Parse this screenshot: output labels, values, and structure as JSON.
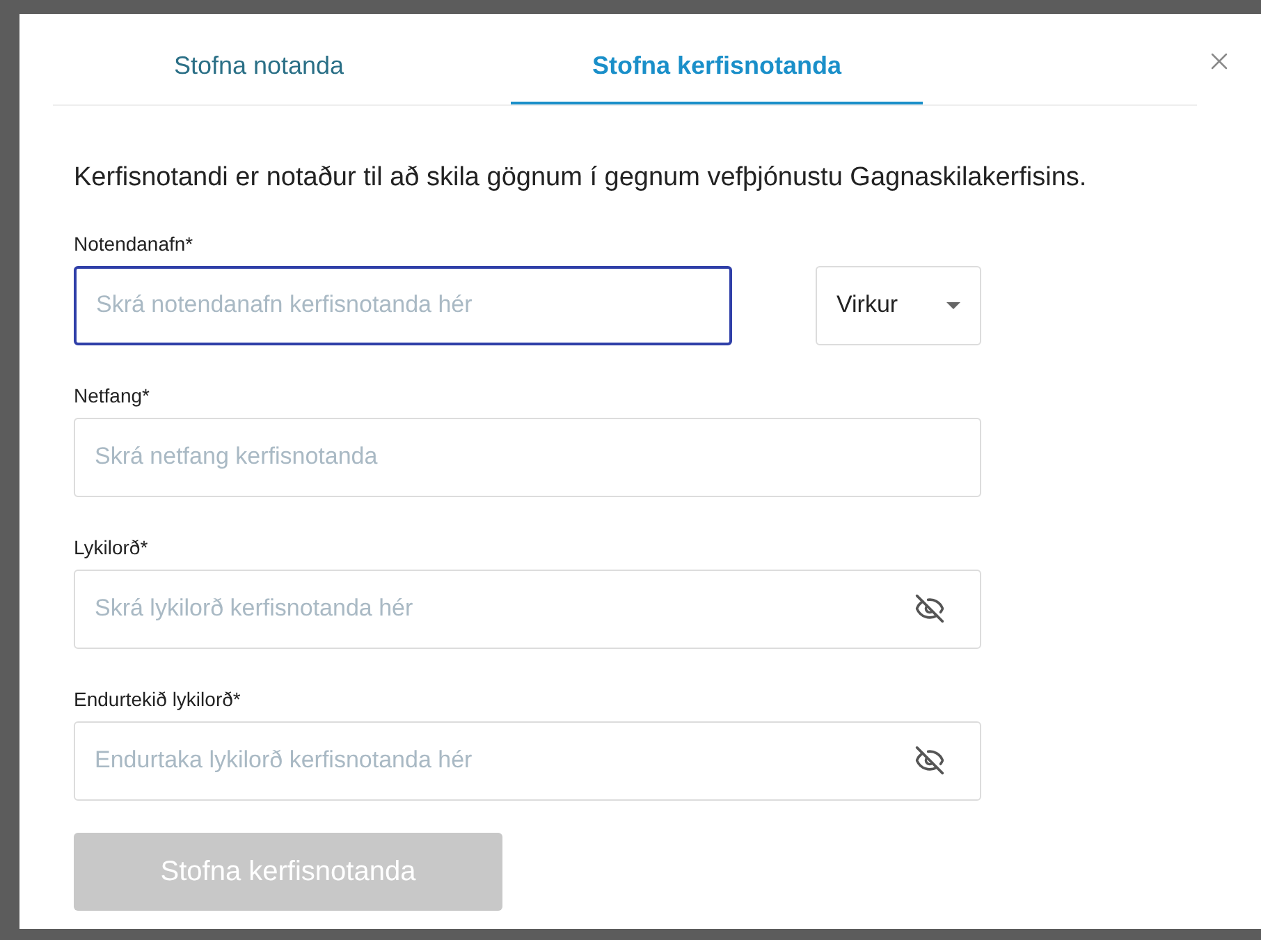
{
  "tabs": [
    {
      "label": "Stofna notanda",
      "selected": false
    },
    {
      "label": "Stofna kerfisnotanda",
      "selected": true
    }
  ],
  "description": "Kerfisnotandi er notaður til að skila gögnum í gegnum vefþjónustu Gagnaskilakerfisins.",
  "fields": [
    {
      "kind": "text",
      "label": "Notendanafn*",
      "placeholder": "Skrá notendanafn kerfisnotanda hér",
      "focused": true,
      "status": {
        "value": "Virkur"
      }
    },
    {
      "kind": "text",
      "label": "Netfang*",
      "placeholder": "Skrá netfang kerfisnotanda",
      "focused": false
    },
    {
      "kind": "password",
      "label": "Lykilorð*",
      "placeholder": "Skrá lykilorð kerfisnotanda hér",
      "focused": false
    },
    {
      "kind": "password",
      "label": "Endurtekið lykilorð*",
      "placeholder": "Endurtaka lykilorð kerfisnotanda hér",
      "focused": false
    }
  ],
  "submit": {
    "label": "Stofna kerfisnotanda",
    "disabled": true
  }
}
